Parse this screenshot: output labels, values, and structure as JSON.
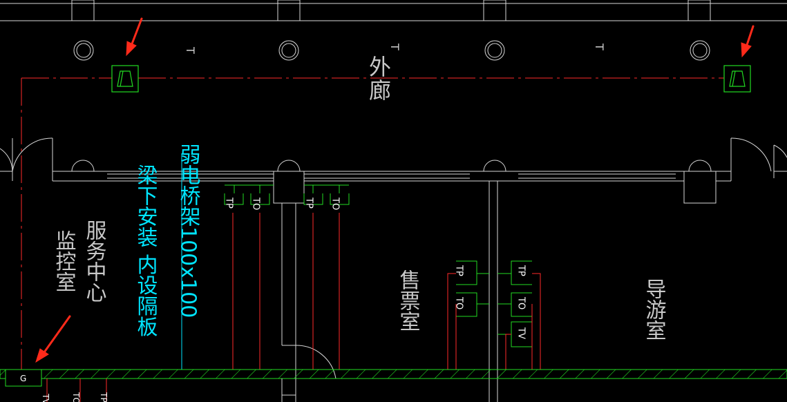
{
  "labels": {
    "corridor": "外廊",
    "service_center": "服务中心",
    "monitor_room": "监控室",
    "ticket_room": "售票室",
    "guide_room": "导游室",
    "tray_note_1": "弱电桥架100x100",
    "tray_note_2": "梁下安装 内设隔板",
    "t_mark": "T",
    "outlet_tp": "TP",
    "outlet_to": "TO",
    "outlet_tv": "TV",
    "g_mark": "G"
  },
  "colors": {
    "background": "#000000",
    "wall": "#d8d8d8",
    "wiring": "#ff2a2a",
    "device": "#22dd22",
    "tray": "#00e5ff",
    "text": "#d0d0d0",
    "arrow": "#ff2a1a"
  },
  "icons": [
    "annotation-arrow-icon",
    "speaker-icon",
    "column-icon",
    "door-swing-icon"
  ]
}
